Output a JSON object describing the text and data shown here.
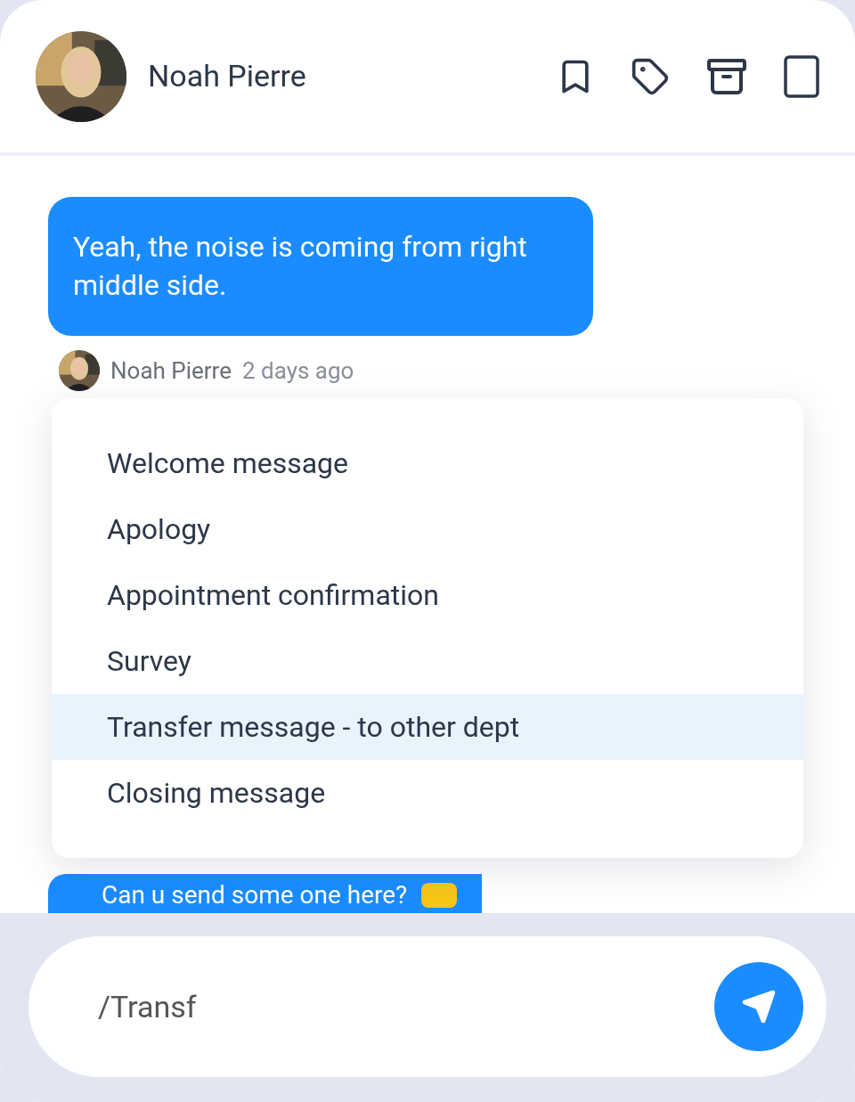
{
  "header": {
    "name": "Noah Pierre"
  },
  "messages": [
    {
      "text": "Yeah, the noise is coming from right middle side.",
      "author": "Noah Pierre",
      "time": "2 days ago"
    },
    {
      "text": "Can u send some one here?"
    }
  ],
  "menu": {
    "items": [
      {
        "label": "Welcome message",
        "selected": false
      },
      {
        "label": "Apology",
        "selected": false
      },
      {
        "label": "Appointment confirmation",
        "selected": false
      },
      {
        "label": "Survey",
        "selected": false
      },
      {
        "label": "Transfer message - to other dept",
        "selected": true
      },
      {
        "label": "Closing message",
        "selected": false
      }
    ]
  },
  "composer": {
    "value": "/Transf"
  }
}
